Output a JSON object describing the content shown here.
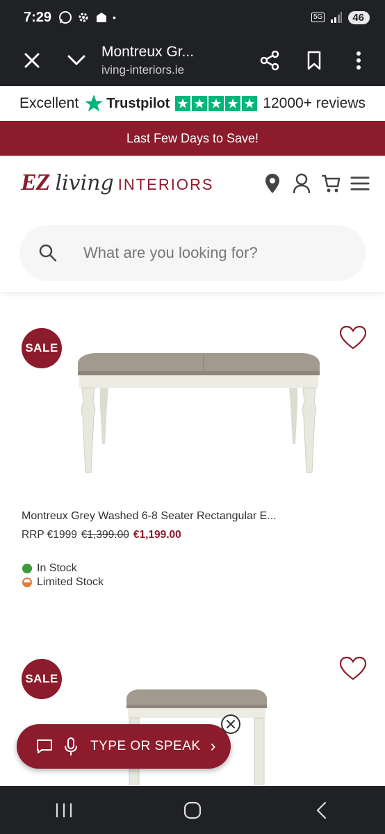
{
  "status_bar": {
    "time": "7:29",
    "network": "5G",
    "battery": "46"
  },
  "toolbar": {
    "title": "Montreux Gr...",
    "url": "iving-interiors.ie"
  },
  "trustpilot": {
    "rating_text": "Excellent",
    "brand": "Trustpilot",
    "reviews": "12000+ reviews",
    "star_color": "#00b67a"
  },
  "promo": {
    "text": "Last Few Days to Save!"
  },
  "logo": {
    "ez": "EZ",
    "living": "living",
    "interiors": "INTERIORS"
  },
  "search": {
    "placeholder": "What are you looking for?"
  },
  "products": [
    {
      "badge": "SALE",
      "name": "Montreux Grey Washed 6-8 Seater Rectangular E...",
      "rrp": "RRP €1999",
      "was": "€1,399.00",
      "now": "€1,199.00",
      "stock": [
        "In Stock",
        "Limited Stock"
      ]
    },
    {
      "badge": "SALE"
    }
  ],
  "assistant": {
    "label": "TYPE OR SPEAK",
    "chevron": "›"
  },
  "colors": {
    "brand": "#8c1b2b",
    "dark": "#202124"
  }
}
